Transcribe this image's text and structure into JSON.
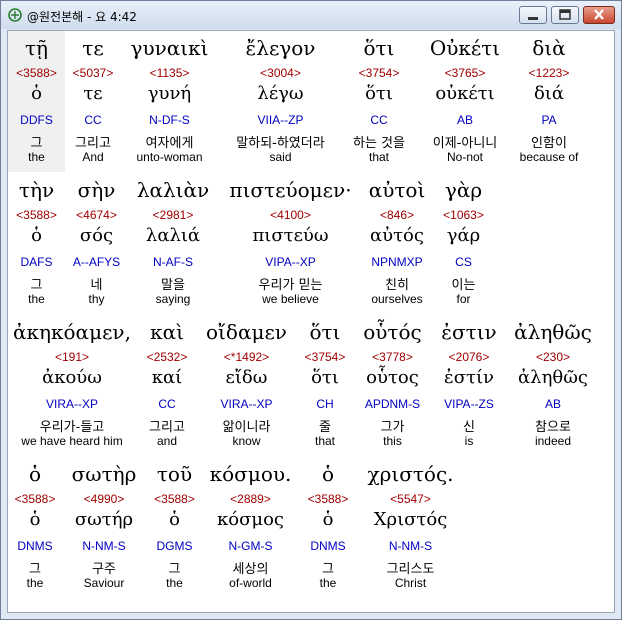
{
  "window": {
    "title": "@원전본해 - 요 4:42"
  },
  "rows": [
    {
      "words": [
        {
          "greek": "τῇ",
          "strong": "<3588>",
          "lemma": "ὁ",
          "parse": "DDFS",
          "korean": "그",
          "english": "the"
        },
        {
          "greek": "τε",
          "strong": "<5037>",
          "lemma": "τε",
          "parse": "CC",
          "korean": "그리고",
          "english": "And"
        },
        {
          "greek": "γυναικὶ",
          "strong": "<1135>",
          "lemma": "γυνή",
          "parse": "N-DF-S",
          "korean": "여자에게",
          "english": "unto-woman"
        },
        {
          "greek": "ἔλεγον",
          "strong": "<3004>",
          "lemma": "λέγω",
          "parse": "VIIA--ZP",
          "korean": "말하되-하였더라",
          "english": "said"
        },
        {
          "greek": "ὅτι",
          "strong": "<3754>",
          "lemma": "ὅτι",
          "parse": "CC",
          "korean": "하는 것을",
          "english": "that"
        },
        {
          "greek": "Οὐκέτι",
          "strong": "<3765>",
          "lemma": "οὐκέτι",
          "parse": "AB",
          "korean": "이제-아니니",
          "english": "No-not"
        },
        {
          "greek": "διὰ",
          "strong": "<1223>",
          "lemma": "διά",
          "parse": "PA",
          "korean": "인함이",
          "english": "because of"
        }
      ]
    },
    {
      "words": [
        {
          "greek": "τὴν",
          "strong": "<3588>",
          "lemma": "ὁ",
          "parse": "DAFS",
          "korean": "그",
          "english": "the"
        },
        {
          "greek": "σὴν",
          "strong": "<4674>",
          "lemma": "σός",
          "parse": "A--AFYS",
          "korean": "네",
          "english": "thy"
        },
        {
          "greek": "λαλιὰν",
          "strong": "<2981>",
          "lemma": "λαλιά",
          "parse": "N-AF-S",
          "korean": "말을",
          "english": "saying"
        },
        {
          "greek": "πιστεύομεν·",
          "strong": "<4100>",
          "lemma": "πιστεύω",
          "parse": "VIPA--XP",
          "korean": "우리가 믿는",
          "english": "we believe"
        },
        {
          "greek": "αὐτοὶ",
          "strong": "<846>",
          "lemma": "αὐτός",
          "parse": "NPNMXP",
          "korean": "친히",
          "english": "ourselves"
        },
        {
          "greek": "γὰρ",
          "strong": "<1063>",
          "lemma": "γάρ",
          "parse": "CS",
          "korean": "이는",
          "english": "for"
        }
      ]
    },
    {
      "words": [
        {
          "greek": "ἀκηκόαμεν,",
          "strong": "<191>",
          "lemma": "ἀκούω",
          "parse": "VIRA--XP",
          "korean": "우리가-들고",
          "english": "we have heard him"
        },
        {
          "greek": "καὶ",
          "strong": "<2532>",
          "lemma": "καί",
          "parse": "CC",
          "korean": "그리고",
          "english": "and"
        },
        {
          "greek": "οἴδαμεν",
          "strong": "<*1492>",
          "lemma": "εἴδω",
          "parse": "VIRA--XP",
          "korean": "앎이니라",
          "english": "know"
        },
        {
          "greek": "ὅτι",
          "strong": "<3754>",
          "lemma": "ὅτι",
          "parse": "CH",
          "korean": "줄",
          "english": "that"
        },
        {
          "greek": "οὗτός",
          "strong": "<3778>",
          "lemma": "οὗτος",
          "parse": "APDNM-S",
          "korean": "그가",
          "english": "this"
        },
        {
          "greek": "ἐστιν",
          "strong": "<2076>",
          "lemma": "ἐστίν",
          "parse": "VIPA--ZS",
          "korean": "신",
          "english": "is"
        },
        {
          "greek": "ἀληθῶς",
          "strong": "<230>",
          "lemma": "ἀληθῶς",
          "parse": "AB",
          "korean": "참으로",
          "english": "indeed"
        }
      ]
    },
    {
      "words": [
        {
          "greek": "ὁ",
          "strong": "<3588>",
          "lemma": "ὁ",
          "parse": "DNMS",
          "korean": "그",
          "english": "the"
        },
        {
          "greek": "σωτὴρ",
          "strong": "<4990>",
          "lemma": "σωτήρ",
          "parse": "N-NM-S",
          "korean": "구주",
          "english": "Saviour"
        },
        {
          "greek": "τοῦ",
          "strong": "<3588>",
          "lemma": "ὁ",
          "parse": "DGMS",
          "korean": "그",
          "english": "the"
        },
        {
          "greek": "κόσμου.",
          "strong": "<2889>",
          "lemma": "κόσμος",
          "parse": "N-GM-S",
          "korean": "세상의",
          "english": "of-world"
        },
        {
          "greek": "ὁ",
          "strong": "<3588>",
          "lemma": "ὁ",
          "parse": "DNMS",
          "korean": "그",
          "english": "the"
        },
        {
          "greek": "χριστός.",
          "strong": "<5547>",
          "lemma": "Χριστός",
          "parse": "N-NM-S",
          "korean": "그리스도",
          "english": "Christ"
        }
      ]
    }
  ]
}
